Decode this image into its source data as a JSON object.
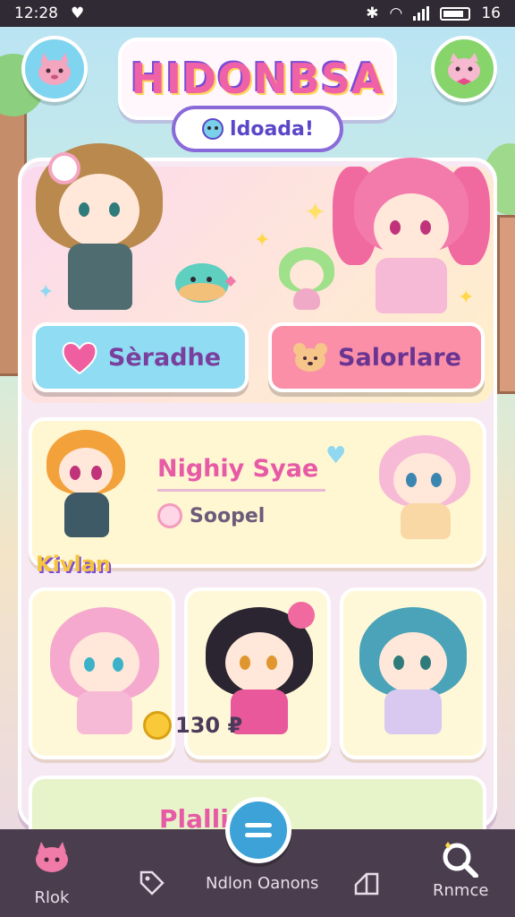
{
  "status_bar": {
    "time": "12:28",
    "battery": "16"
  },
  "header": {
    "title": "HIDONBSA",
    "subtitle": "ldoada!",
    "left_button_icon": "pet-face-icon",
    "right_button_icon": "pet-face-icon"
  },
  "hero": {
    "button_left_label": "Sèradhe",
    "button_left_icon": "heart-icon",
    "button_right_label": "Salorlare",
    "button_right_icon": "bear-face-icon"
  },
  "event": {
    "title": "Nighiy Syae",
    "subtitle": "Soopel",
    "label": "Kivlan"
  },
  "shop": {
    "price": "130 ₽"
  },
  "peek": {
    "title": "Plalli..."
  },
  "bottom_nav": {
    "items": [
      {
        "label": "Rlok",
        "icon": "pet-home-icon"
      },
      {
        "label": "",
        "icon": "tag-icon"
      },
      {
        "label": "Ndlon Oanons",
        "icon": "menu-fab-icon"
      },
      {
        "label": "",
        "icon": "chart-icon"
      },
      {
        "label": "Rnmce",
        "icon": "search-icon"
      }
    ]
  },
  "colors": {
    "primary_pink": "#e75aa6",
    "accent_blue": "#3da2d8",
    "nav_bg": "#4a3e4e"
  }
}
